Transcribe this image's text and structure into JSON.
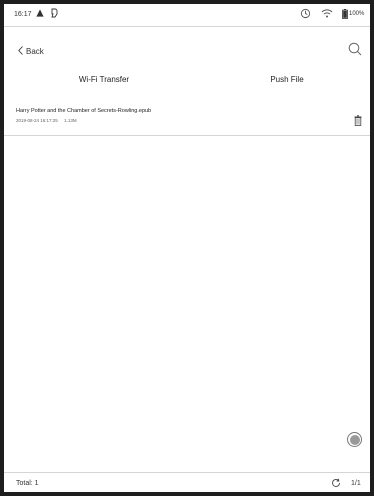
{
  "status_bar": {
    "time": "16:17",
    "battery": "100%"
  },
  "header": {
    "back_label": "Back",
    "tabs": [
      {
        "label": "Wi-Fi Transfer"
      },
      {
        "label": "Push File"
      }
    ]
  },
  "files": [
    {
      "name": "Harry Potter and the Chamber of Secrets-Rowling.epub",
      "date": "2019-08-24 16:17:25",
      "size": "1.13M"
    }
  ],
  "footer": {
    "total": "Total: 1",
    "page": "1/1"
  },
  "icons": {
    "status_left": [
      "warning-icon",
      "notification-icon"
    ],
    "status_right": [
      "sync-icon",
      "wifi-icon",
      "battery-icon"
    ],
    "header": [
      "back-chevron-icon",
      "search-icon"
    ],
    "file_item": [
      "trash-icon"
    ],
    "footer": [
      "refresh-icon"
    ],
    "floating": [
      "floating-button"
    ]
  }
}
